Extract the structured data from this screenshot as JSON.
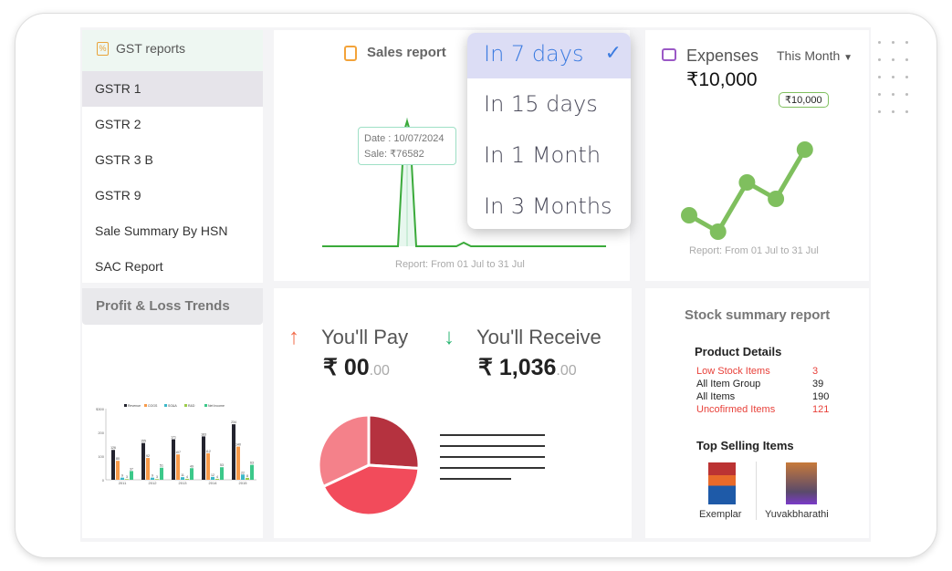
{
  "gst": {
    "title": "GST reports",
    "items": [
      "GSTR 1",
      "GSTR 2",
      "GSTR 3 B",
      "GSTR 9",
      "Sale Summary By HSN",
      "SAC Report"
    ],
    "selected": "GSTR 1"
  },
  "pl": {
    "title": "Profit & Loss Trends"
  },
  "sales": {
    "title": "Sales report",
    "tooltip_date": "Date : 10/07/2024",
    "tooltip_sale": "Sale: ₹76582",
    "footer": "Report: From 01 Jul to 31 Jul"
  },
  "dropdown": {
    "options": [
      "In 7 days",
      "In 15 days",
      "In 1 Month",
      "In 3 Months"
    ],
    "selected": "In 7 days"
  },
  "expenses": {
    "title": "Expenses",
    "period": "This Month",
    "amount": "₹10,000",
    "point_label": "₹10,000",
    "footer": "Report: From 01 Jul to 31 Jul",
    "values": [
      2,
      1,
      4,
      3,
      6
    ],
    "color": "#7fbf5e"
  },
  "pay": {
    "pay_label": "You'll Pay",
    "pay_amount": "₹ 00",
    "pay_dec": ".00",
    "receive_label": "You'll Receive",
    "receive_amount": "₹ 1,036",
    "receive_dec": ".00",
    "pie": [
      26,
      42,
      32
    ],
    "pie_colors": [
      "#b5323f",
      "#f24b5b",
      "#f4818a"
    ]
  },
  "stock": {
    "title": "Stock summary report",
    "details_title": "Product Details",
    "details": [
      {
        "label": "Low Stock Items",
        "value": "3",
        "alert": true
      },
      {
        "label": "All Item Group",
        "value": "39",
        "alert": false
      },
      {
        "label": "All Items",
        "value": "190",
        "alert": false
      },
      {
        "label": "Uncofirmed Items",
        "value": "121",
        "alert": true
      }
    ],
    "top_title": "Top Selling Items",
    "top_items": [
      "Exemplar",
      "Yuvakbharathi"
    ]
  },
  "chart_data": {
    "type": "bar",
    "categories": [
      "2011",
      "2012",
      "2013",
      "2014",
      "2015"
    ],
    "series": [
      {
        "name": "Revenue",
        "values": [
          126,
          155,
          171,
          183,
          234
        ]
      },
      {
        "name": "COGS",
        "values": [
          80,
          92,
          107,
          112,
          140
        ]
      },
      {
        "name": "SG&A",
        "values": [
          9,
          9,
          11,
          12,
          22
        ]
      },
      {
        "name": "R&D",
        "values": [
          3,
          3,
          4,
          4,
          8
        ]
      },
      {
        "name": "Net Income",
        "values": [
          37,
          51,
          49,
          53,
          63
        ]
      }
    ],
    "colors": [
      "#23232e",
      "#f79a4a",
      "#3cb8c8",
      "#9ccc4a",
      "#3cc88a"
    ],
    "yticks": [
      "0",
      "100",
      "200",
      "$300"
    ],
    "ylim": [
      0,
      300
    ],
    "legend": "top"
  }
}
